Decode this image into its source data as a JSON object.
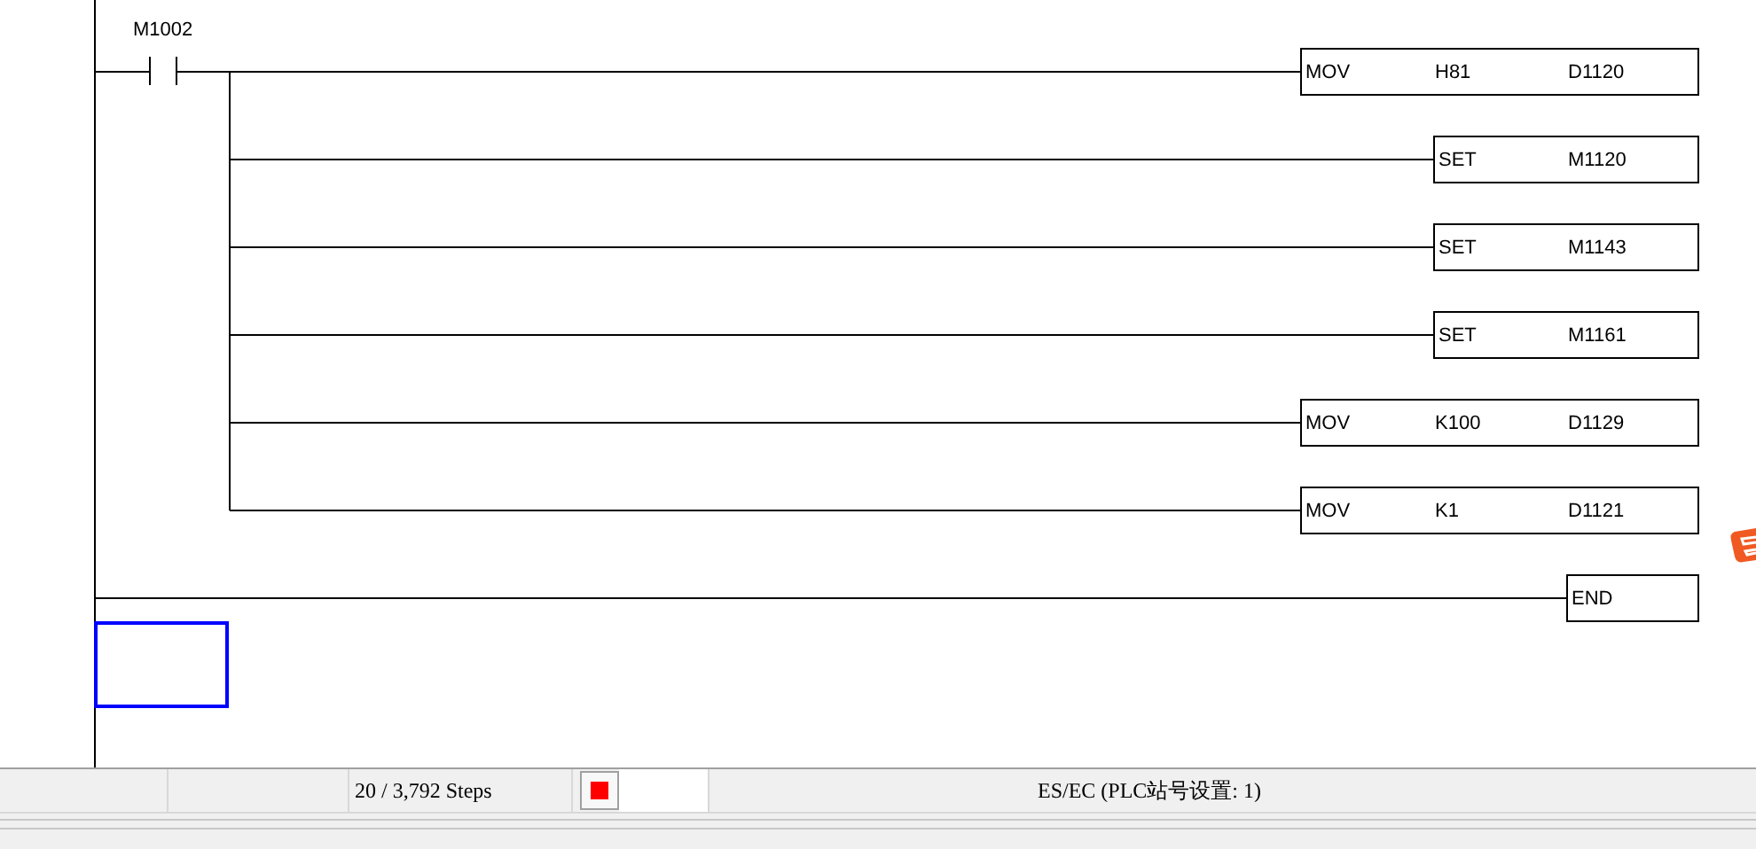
{
  "ladder": {
    "contact": {
      "label": "M1002"
    },
    "instructions": [
      {
        "kind": "output",
        "mnemonic": "MOV",
        "operands": [
          "H81",
          "D1120"
        ]
      },
      {
        "kind": "output",
        "mnemonic": "SET",
        "operands": [
          "M1120"
        ]
      },
      {
        "kind": "output",
        "mnemonic": "SET",
        "operands": [
          "M1143"
        ]
      },
      {
        "kind": "output",
        "mnemonic": "SET",
        "operands": [
          "M1161"
        ]
      },
      {
        "kind": "output",
        "mnemonic": "MOV",
        "operands": [
          "K100",
          "D1129"
        ]
      },
      {
        "kind": "output",
        "mnemonic": "MOV",
        "operands": [
          "K1",
          "D1121"
        ]
      }
    ],
    "end": {
      "mnemonic": "END"
    }
  },
  "status_bar": {
    "steps": "20 / 3,792 Steps",
    "indicator": {
      "color": "#ff0000"
    },
    "station": "ES/EC (PLC站号设置: 1)"
  }
}
